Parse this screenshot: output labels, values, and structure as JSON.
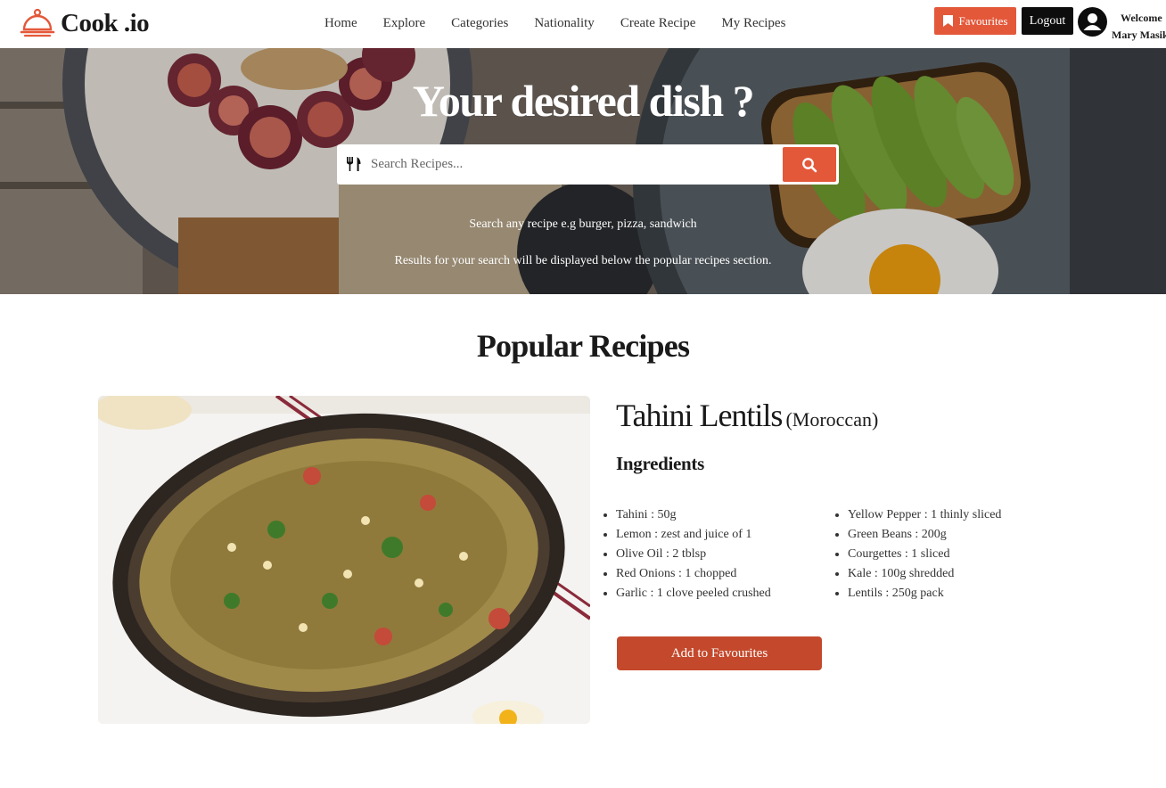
{
  "brand": {
    "name": "Cook .io",
    "logo_icon": "cloche-icon",
    "accent_color": "#e4583a"
  },
  "nav": {
    "links": [
      "Home",
      "Explore",
      "Categories",
      "Nationality",
      "Create Recipe",
      "My Recipes"
    ],
    "favourites_label": "Favourites",
    "logout_label": "Logout",
    "welcome_label": "Welcome",
    "user_name": "Mary Masika"
  },
  "hero": {
    "title": "Your desired dish ?",
    "search_placeholder": "Search Recipes...",
    "hint_1": "Search any recipe e.g burger, pizza, sandwich",
    "hint_2": "Results for your search will be displayed below the popular recipes section."
  },
  "popular": {
    "title": "Popular Recipes",
    "recipe": {
      "name": "Tahini Lentils",
      "nationality": "(Moroccan)",
      "ingredients_heading": "Ingredients",
      "ingredients_col1": [
        "Tahini : 50g",
        "Lemon : zest and juice of 1",
        "Olive Oil : 2 tblsp",
        "Red Onions : 1 chopped",
        "Garlic : 1 clove peeled crushed"
      ],
      "ingredients_col2": [
        "Yellow Pepper : 1 thinly sliced",
        "Green Beans : 200g",
        "Courgettes : 1 sliced",
        "Kale : 100g shredded",
        "Lentils : 250g pack"
      ],
      "add_label": "Add to Favourites"
    }
  }
}
